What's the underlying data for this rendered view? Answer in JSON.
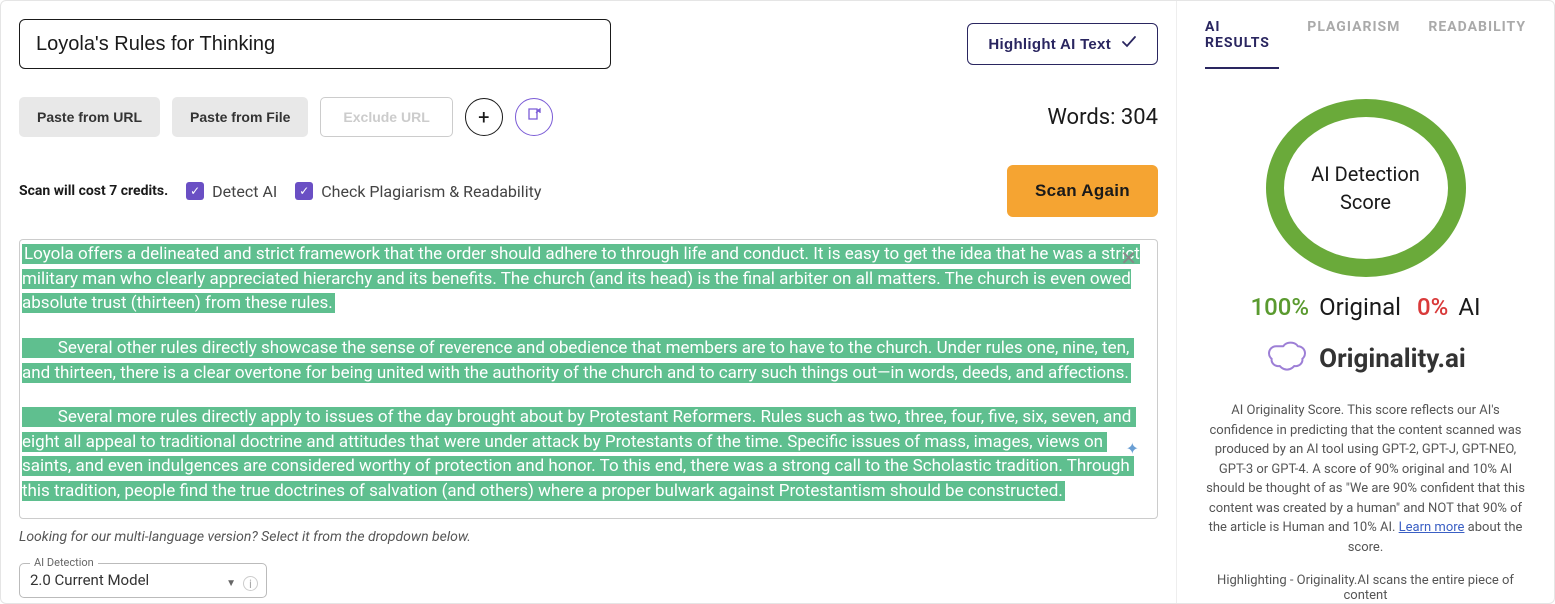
{
  "title": "Loyola's Rules for Thinking",
  "highlight_btn": "Highlight AI Text",
  "toolbar": {
    "paste_url": "Paste from URL",
    "paste_file": "Paste from File",
    "exclude_url": "Exclude URL",
    "words_label": "Words:",
    "words_count": "304"
  },
  "scan": {
    "credits": "Scan will cost 7 credits.",
    "detect_ai": "Detect AI",
    "check_plag": "Check Plagiarism & Readability",
    "scan_btn": "Scan Again"
  },
  "content": {
    "p1": "Loyola offers a delineated and strict framework that the order should adhere to through life and conduct. It is easy to get the idea that he was a strict military man who clearly appreciated hierarchy and its benefits. The church (and its head) is the final arbiter on all matters. The church is even owed absolute trust (thirteen) from these rules.",
    "p2_indent": "        Several other rules directly showcase the sense of reverence and obedience that members are to have to the church. Under rules one, nine, ten, and thirteen, there is a clear overtone for being united with the authority of the church and to carry such things out—in words, deeds, and affections.",
    "p3_indent": "        Several more rules directly apply to issues of the day brought about by Protestant Reformers. Rules such as two, three, four, five, six, seven, and eight all appeal to traditional doctrine and attitudes that were under attack by Protestants of the time. Specific issues of mass, images, views on saints, and even indulgences are considered worthy of protection and honor. To this end, there was a strong call to the Scholastic tradition. Through this tradition, people find the true doctrines of salvation (and others) where a proper bulwark against Protestantism should be constructed."
  },
  "multilang": "Looking for our multi-language version? Select it from the dropdown below.",
  "model": {
    "label": "AI Detection",
    "value": "2.0 Current Model"
  },
  "right": {
    "tabs": {
      "ai": "AI RESULTS",
      "plag": "PLAGIARISM",
      "read": "READABILITY"
    },
    "gauge_label": "AI Detection Score",
    "score": {
      "orig_pct": "100%",
      "orig_lbl": "Original",
      "ai_pct": "0%",
      "ai_lbl": "AI"
    },
    "brand": "Originality.ai",
    "desc_a": "AI Originality Score. This score reflects our AI's confidence in predicting that the content scanned was produced by an AI tool using GPT-2, GPT-J, GPT-NEO, GPT-3 or GPT-4. A score of 90% original and 10% AI should be thought of as \"We are 90% confident that this content was created by a human\" and NOT that 90% of the article is Human and 10% AI. ",
    "learn_more": "Learn more",
    "desc_b": " about the score.",
    "hl_desc": "Highlighting - Originality.AI scans the entire piece of content"
  }
}
